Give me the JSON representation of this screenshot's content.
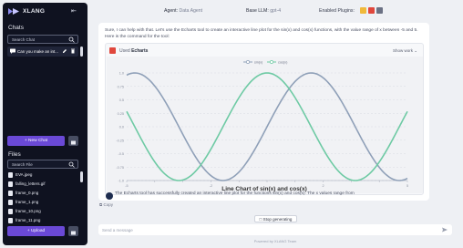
{
  "sidebar": {
    "app_name": "XLANG",
    "chats_title": "Chats",
    "chat_search_placeholder": "Search Chat",
    "chats": [
      {
        "title": "Can you make an int..."
      }
    ],
    "new_chat_label": "+ New Chat",
    "files_title": "Files",
    "file_search_placeholder": "Search File",
    "files": [
      {
        "name": "EVA.jpeg"
      },
      {
        "name": "falling_letters.gif"
      },
      {
        "name": "frame_0.png"
      },
      {
        "name": "frame_1.png"
      },
      {
        "name": "frame_10.png"
      },
      {
        "name": "frame_11.png"
      }
    ],
    "upload_label": "+ Upload"
  },
  "header": {
    "agent_label": "Agent:",
    "agent_value": "Data Agent",
    "llm_label": "Base LLM:",
    "llm_value": "gpt-4",
    "plugins_label": "Enabled Plugins:"
  },
  "message": {
    "intro": "Sure, I can help with that. Let's use the Echarts tool to create an interactive line plot for the sin(x) and cos(x) functions, with the value range of x between -5 and 5. Here is the command for the tool:",
    "tool_used_prefix": "Used",
    "tool_name": "Echarts",
    "show_work_label": "Show work",
    "result": "The Echarts tool has successfully created an interactive line plot for the functions sin(x) and cos(x). The x values range from",
    "copy_label": "Copy"
  },
  "chart_data": {
    "type": "line",
    "title": "Line Chart of sin(x) and cos(x)",
    "legend": [
      "sin(x)",
      "cos(x)"
    ],
    "legend_position": "top-center",
    "xlim": [
      -5,
      5
    ],
    "ylim": [
      -1,
      1
    ],
    "x_ticks": [
      -5,
      -4,
      -3,
      -2,
      -1,
      0,
      1,
      2,
      3,
      4,
      5
    ],
    "x_tick_labels": [
      "-5",
      "",
      "",
      "-2",
      "",
      "",
      "",
      "2",
      "",
      "",
      "5"
    ],
    "y_ticks": [
      1,
      0.75,
      0.5,
      0.25,
      0,
      -0.25,
      -0.5,
      -0.75,
      -1
    ],
    "y_tick_labels": [
      "1.0",
      "0.75",
      "0.5",
      "0.25",
      "0.0",
      "-0.25",
      "-0.5",
      "-0.75",
      "-1.0"
    ],
    "grid": true,
    "series": [
      {
        "name": "sin(x)",
        "function": "sin",
        "color": "#8fa0b8"
      },
      {
        "name": "cos(x)",
        "function": "cos",
        "color": "#6ecaa4"
      }
    ]
  },
  "controls": {
    "stop_label": "Stop generating",
    "input_placeholder": "Send a message",
    "powered_by": "Powered by XLANG Team"
  },
  "colors": {
    "accent": "#6a49d6",
    "sidebar_bg": "#0f1220"
  }
}
